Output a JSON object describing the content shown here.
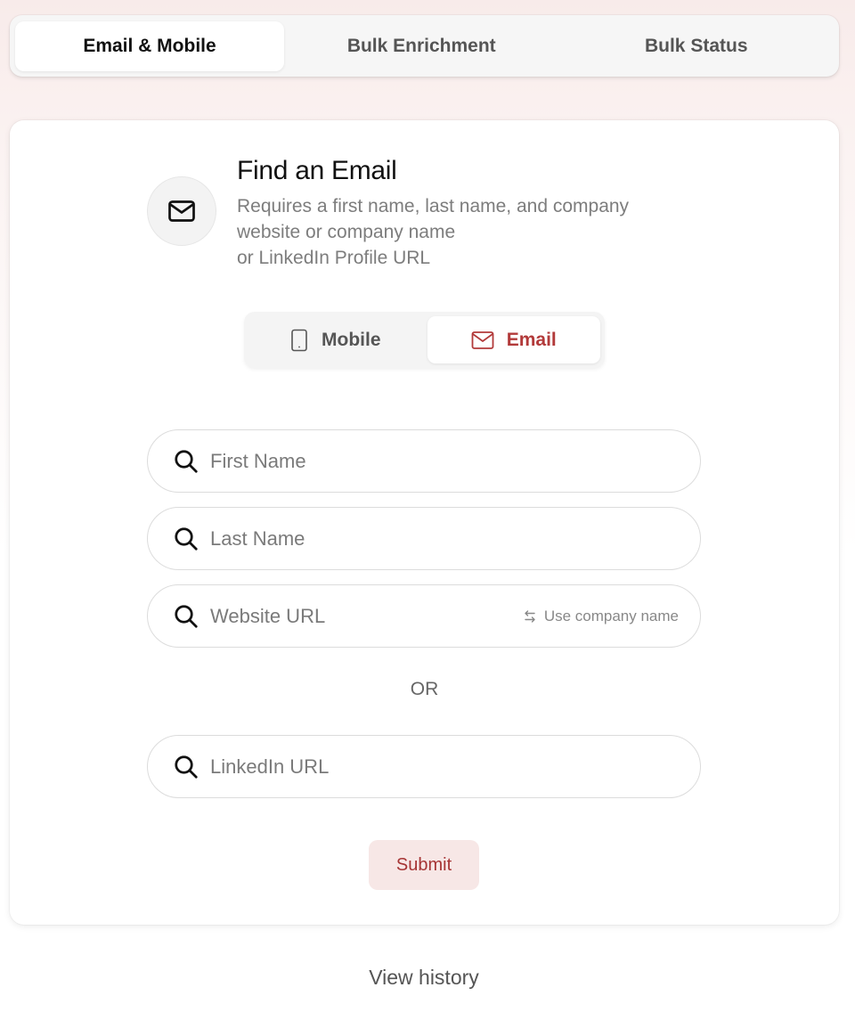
{
  "tabs": [
    {
      "label": "Email & Mobile",
      "active": true
    },
    {
      "label": "Bulk Enrichment",
      "active": false
    },
    {
      "label": "Bulk Status",
      "active": false
    }
  ],
  "card": {
    "title": "Find an Email",
    "subtitle_lines": [
      "Requires a first name, last name, and company",
      "website or company name",
      "or LinkedIn Profile URL"
    ],
    "header_icon": "mail-icon"
  },
  "toggle": {
    "mobile_label": "Mobile",
    "email_label": "Email",
    "selected": "Email"
  },
  "fields": {
    "first_name": {
      "placeholder": "First Name",
      "value": ""
    },
    "last_name": {
      "placeholder": "Last Name",
      "value": ""
    },
    "website": {
      "placeholder": "Website URL",
      "value": "",
      "switch_label": "Use company name"
    },
    "linkedin": {
      "placeholder": "LinkedIn URL",
      "value": ""
    }
  },
  "or_label": "OR",
  "submit_label": "Submit",
  "view_history_label": "View history",
  "colors": {
    "accent": "#b23a3a",
    "submit_bg": "#f7e7e6",
    "page_tint": "#f8ebea"
  }
}
